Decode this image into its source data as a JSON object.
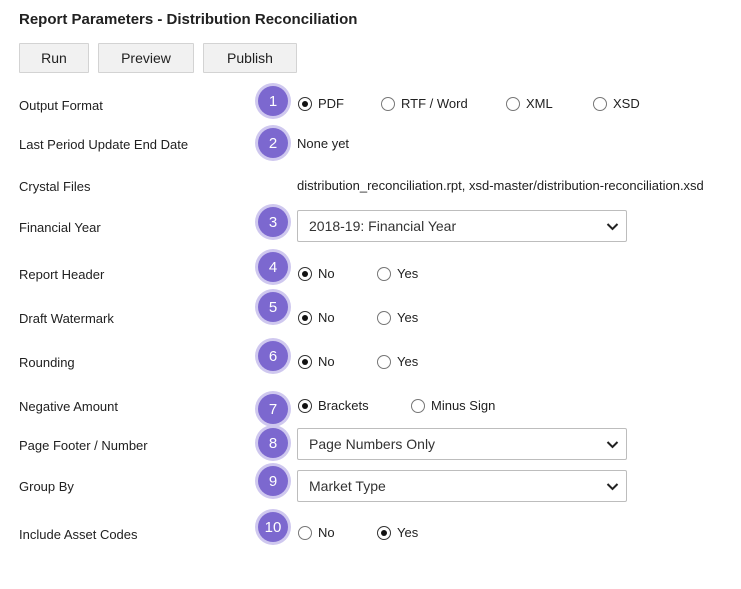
{
  "page": {
    "title": "Report Parameters - Distribution Reconciliation"
  },
  "toolbar": {
    "run": "Run",
    "preview": "Preview",
    "publish": "Publish"
  },
  "fields": {
    "output_format": {
      "label": "Output Format",
      "step": "1",
      "options": [
        "PDF",
        "RTF / Word",
        "XML",
        "XSD"
      ],
      "selected": "PDF"
    },
    "last_period": {
      "label": "Last Period Update End Date",
      "step": "2",
      "value": "None yet"
    },
    "crystal_files": {
      "label": "Crystal Files",
      "value": "distribution_reconciliation.rpt, xsd-master/distribution-reconciliation.xsd"
    },
    "financial_year": {
      "label": "Financial Year",
      "step": "3",
      "value": "2018-19: Financial Year"
    },
    "report_header": {
      "label": "Report Header",
      "step": "4",
      "options": [
        "No",
        "Yes"
      ],
      "selected": "No"
    },
    "draft_watermark": {
      "label": "Draft Watermark",
      "step": "5",
      "options": [
        "No",
        "Yes"
      ],
      "selected": "No"
    },
    "rounding": {
      "label": "Rounding",
      "step": "6",
      "options": [
        "No",
        "Yes"
      ],
      "selected": "No"
    },
    "negative_amount": {
      "label": "Negative Amount",
      "step": "7",
      "options": [
        "Brackets",
        "Minus Sign"
      ],
      "selected": "Brackets"
    },
    "page_footer": {
      "label": "Page Footer / Number",
      "step": "8",
      "value": "Page Numbers Only"
    },
    "group_by": {
      "label": "Group By",
      "step": "9",
      "value": "Market Type"
    },
    "include_asset_codes": {
      "label": "Include Asset Codes",
      "step": "10",
      "options": [
        "No",
        "Yes"
      ],
      "selected": "Yes"
    }
  },
  "colors": {
    "step_badge": "#7c68cf",
    "step_ring": "#cfc8ef",
    "button_bg": "#f1f1f1"
  },
  "icons": {
    "select_arrow": "chevron-down-icon"
  }
}
